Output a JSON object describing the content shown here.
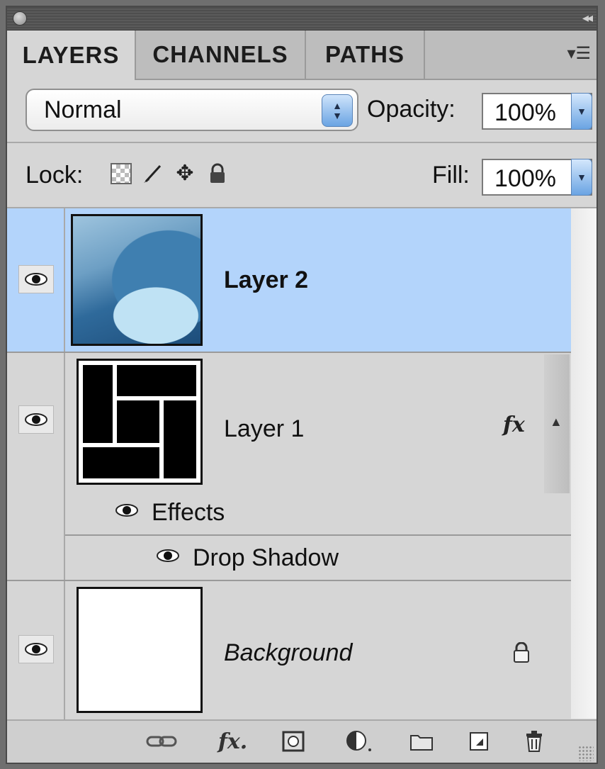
{
  "tabs": [
    {
      "label": "LAYERS",
      "active": true
    },
    {
      "label": "CHANNELS",
      "active": false
    },
    {
      "label": "PATHS",
      "active": false
    }
  ],
  "blend": {
    "mode": "Normal"
  },
  "opacity": {
    "label": "Opacity:",
    "value": "100%"
  },
  "lock": {
    "label": "Lock:"
  },
  "fill": {
    "label": "Fill:",
    "value": "100%"
  },
  "layers": [
    {
      "name": "Layer 2",
      "selected": true,
      "visible": true
    },
    {
      "name": "Layer 1",
      "selected": false,
      "visible": true,
      "has_effects": true,
      "effects_label": "Effects",
      "effects": [
        {
          "name": "Drop Shadow"
        }
      ]
    },
    {
      "name": "Background",
      "selected": false,
      "visible": true,
      "locked": true
    }
  ],
  "icons": {
    "eye": "eye-icon",
    "fx": "fx-icon",
    "lock": "lock-icon"
  },
  "colors": {
    "panel": "#d6d6d6",
    "selection": "#b3d4fb",
    "tab_inactive": "#bdbdbd",
    "accent_blue": "#6aa4e3"
  }
}
